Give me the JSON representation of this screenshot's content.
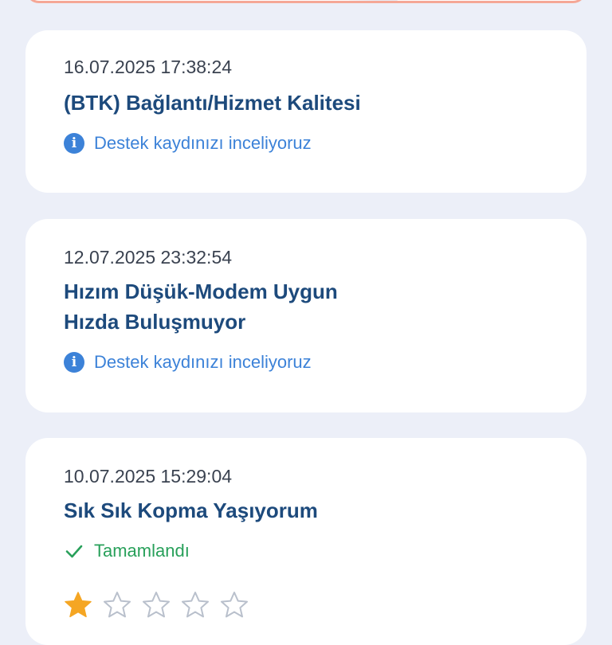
{
  "tickets": [
    {
      "date": "16.07.2025 17:38:24",
      "title": "(BTK) Bağlantı/Hizmet Kalitesi",
      "status": "Destek kaydınızı inceliyoruz"
    },
    {
      "date": "12.07.2025 23:32:54",
      "title_line1": "Hızım Düşük-Modem Uygun",
      "title_line2": "Hızda Buluşmuyor",
      "status": "Destek kaydınızı inceliyoruz"
    },
    {
      "date": "10.07.2025 15:29:04",
      "title": "Sık Sık Kopma Yaşıyorum",
      "status": "Tamamlandı",
      "rating": 1,
      "rating_max": 5
    }
  ],
  "icons": {
    "info": "info-icon",
    "check": "check-icon",
    "star": "star-icon"
  },
  "colors": {
    "background": "#eceff8",
    "title": "#1d4a7c",
    "info_status": "#3c82d8",
    "done_status": "#28a05a",
    "star_filled": "#f5a623",
    "top_card_border": "#f5a796"
  }
}
